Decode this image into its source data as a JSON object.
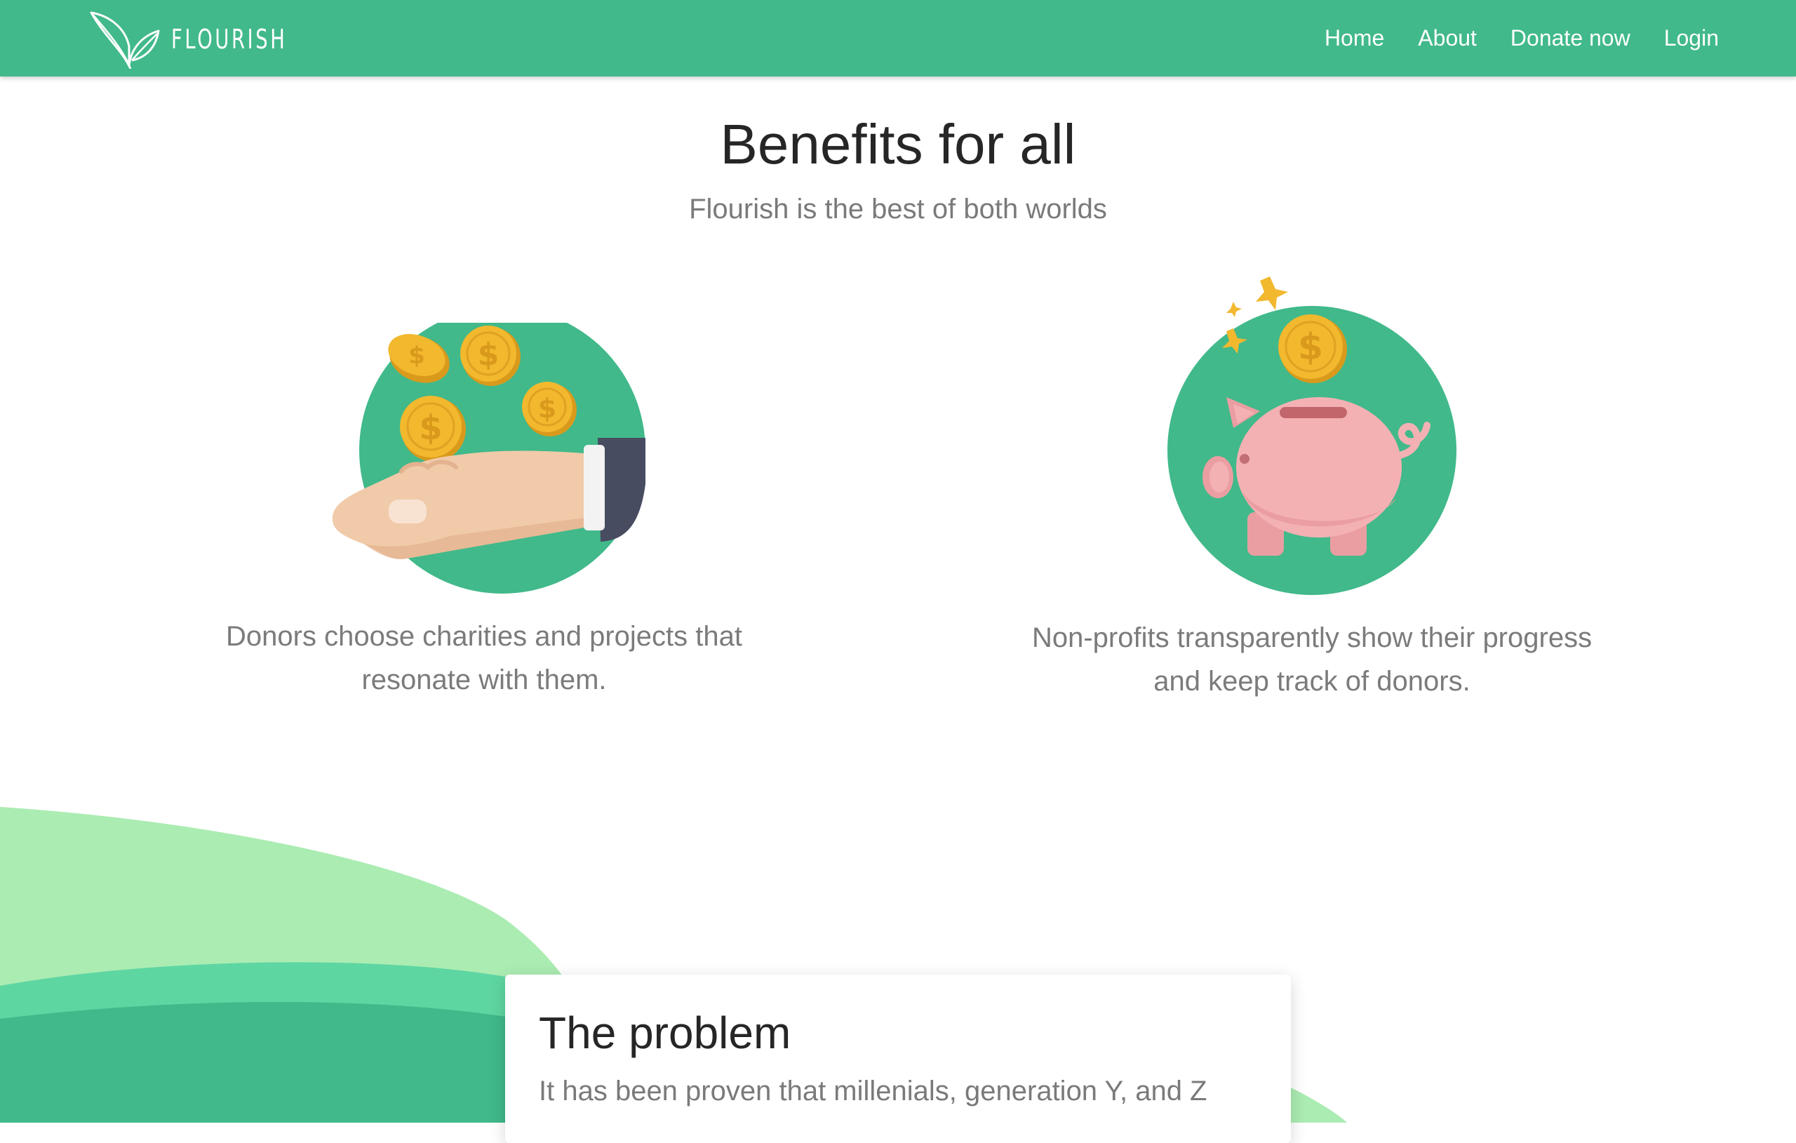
{
  "navbar": {
    "brand": "FLOURISH",
    "logo_icon": "leaf-icon",
    "links": [
      "Home",
      "About",
      "Donate now",
      "Login"
    ],
    "color": "#41b98a"
  },
  "hero": {
    "title": "Benefits for all",
    "subtitle": "Flourish is the best of both worlds"
  },
  "features": [
    {
      "illustration": "hand-with-coins-icon",
      "text_lines": [
        "Donors choose charities and projects that",
        "resonate with them."
      ]
    },
    {
      "illustration": "piggy-bank-icon",
      "text_lines": [
        "Non-profits transparently show their progress",
        "and keep track of donors."
      ]
    }
  ],
  "problem": {
    "title": "The problem",
    "text": "It has been proven that millenials, generation Y, and Z"
  },
  "colors": {
    "accent": "#41b98a",
    "wave_light": "#abecb2",
    "wave_mid": "#5ed6a2",
    "wave_dark": "#41b98a",
    "coin": "#f2b82e",
    "piggy": "#f4b1b4"
  }
}
